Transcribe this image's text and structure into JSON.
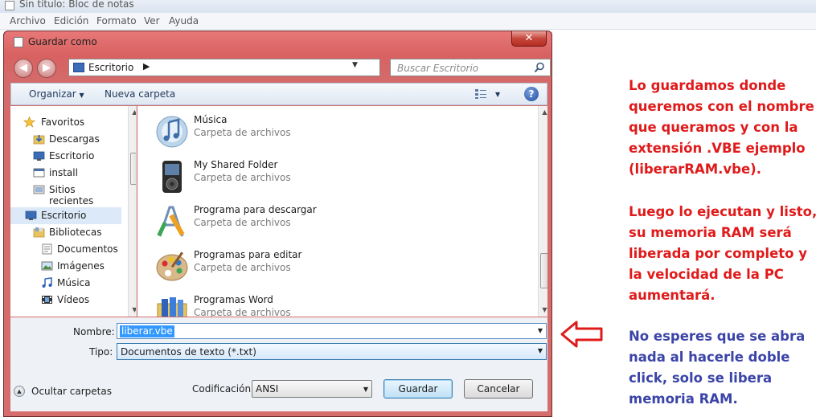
{
  "notepad": {
    "title": "Sin título: Bloc de notas",
    "menu": [
      "Archivo",
      "Edición",
      "Formato",
      "Ver",
      "Ayuda"
    ]
  },
  "dialog": {
    "title": "Guardar como",
    "close": "✕",
    "address": {
      "location": "Escritorio"
    },
    "search_placeholder": "Buscar Escritorio",
    "toolbar": {
      "organize": "Organizar",
      "new_folder": "Nueva carpeta"
    },
    "nav": {
      "items": [
        {
          "label": "Favoritos",
          "icon": "star-icon"
        },
        {
          "label": "Descargas",
          "icon": "downloads-folder-icon"
        },
        {
          "label": "Escritorio",
          "icon": "desktop-icon"
        },
        {
          "label": "install",
          "icon": "window-icon"
        },
        {
          "label": "Sitios recientes",
          "icon": "recent-places-icon"
        },
        {
          "label": "Escritorio",
          "icon": "desktop-icon"
        },
        {
          "label": "Bibliotecas",
          "icon": "libraries-icon"
        },
        {
          "label": "Documentos",
          "icon": "documents-icon"
        },
        {
          "label": "Imágenes",
          "icon": "pictures-icon"
        },
        {
          "label": "Música",
          "icon": "music-icon"
        },
        {
          "label": "Vídeos",
          "icon": "videos-icon"
        }
      ]
    },
    "files": [
      {
        "name": "Música",
        "type": "Carpeta de archivos",
        "icon": "music-folder-icon"
      },
      {
        "name": "My Shared Folder",
        "type": "Carpeta de archivos",
        "icon": "mp3-player-icon"
      },
      {
        "name": "Programa para descargar",
        "type": "Carpeta de archivos",
        "icon": "drawing-tools-icon"
      },
      {
        "name": "Programas para editar",
        "type": "Carpeta de archivos",
        "icon": "paint-palette-icon"
      },
      {
        "name": "Programas Word",
        "type": "Carpeta de archivos",
        "icon": "folder-icon"
      }
    ],
    "form": {
      "name_label": "Nombre:",
      "name_value": "liberar.vbe",
      "type_label": "Tipo:",
      "type_value": "Documentos de texto (*.txt)",
      "hide_folders": "Ocultar carpetas",
      "encoding_label": "Codificación:",
      "encoding_value": "ANSI",
      "save": "Guardar",
      "cancel": "Cancelar"
    }
  },
  "notes": {
    "red_paragraph_1": [
      "Lo guardamos donde",
      "queremos con el nombre",
      "que queramos y con la",
      "extensión .VBE ejemplo",
      "(liberarRAM.vbe)."
    ],
    "red_paragraph_2": [
      "Luego lo ejecutan y listo,",
      "su memoria RAM será",
      "liberada por completo y",
      "la velocidad de la PC",
      "aumentará."
    ],
    "blue_paragraph": [
      "No esperes que se abra",
      "nada al hacerle doble",
      "click, solo se libera",
      "memoria RAM."
    ],
    "colors": {
      "red": "#e01a1a",
      "blue": "#3b44a8"
    }
  }
}
